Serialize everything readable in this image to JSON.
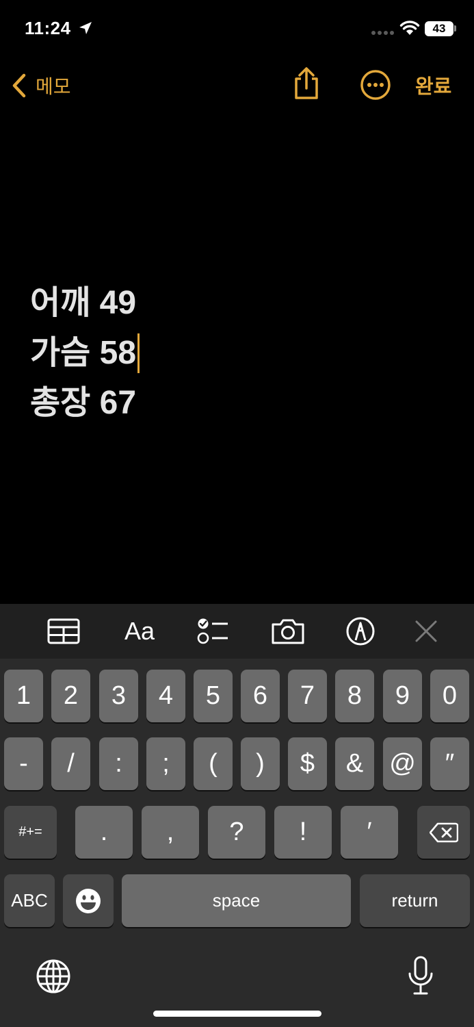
{
  "status_bar": {
    "time": "11:24",
    "battery": "43",
    "icons": [
      "location-arrow-icon",
      "signal-dots-icon",
      "wifi-icon",
      "battery-icon"
    ]
  },
  "nav": {
    "back_label": "메모",
    "done_label": "완료",
    "icons": [
      "chevron-left-icon",
      "share-icon",
      "more-circle-icon"
    ]
  },
  "colors": {
    "accent": "#e3a83b",
    "background": "#000000",
    "text": "#e4e4e4",
    "keyboard_bg": "#2b2b2b",
    "key_bg": "#6b6b6b",
    "key_dark_bg": "#474747"
  },
  "note": {
    "lines": [
      "어깨 49",
      "가슴 58",
      "총장 67"
    ]
  },
  "format_bar": {
    "aa_label": "Aa",
    "icons": [
      "table-icon",
      "text-format-icon",
      "checklist-icon",
      "camera-icon",
      "markup-pen-icon",
      "close-icon"
    ]
  },
  "keyboard": {
    "row1": [
      "1",
      "2",
      "3",
      "4",
      "5",
      "6",
      "7",
      "8",
      "9",
      "0"
    ],
    "row2": [
      "-",
      "/",
      ":",
      ";",
      "(",
      ")",
      "$",
      "&",
      "@",
      "″"
    ],
    "row3": {
      "mode_key": "#+=",
      "keys": [
        ".",
        ",",
        "?",
        "!",
        "′"
      ],
      "delete_icon": "delete-backspace-icon"
    },
    "row4": {
      "abc_key": "ABC",
      "space_label": "space",
      "return_label": "return",
      "emoji_icon": "emoji-icon"
    },
    "bottom": {
      "icons": [
        "globe-icon",
        "microphone-icon"
      ]
    }
  }
}
